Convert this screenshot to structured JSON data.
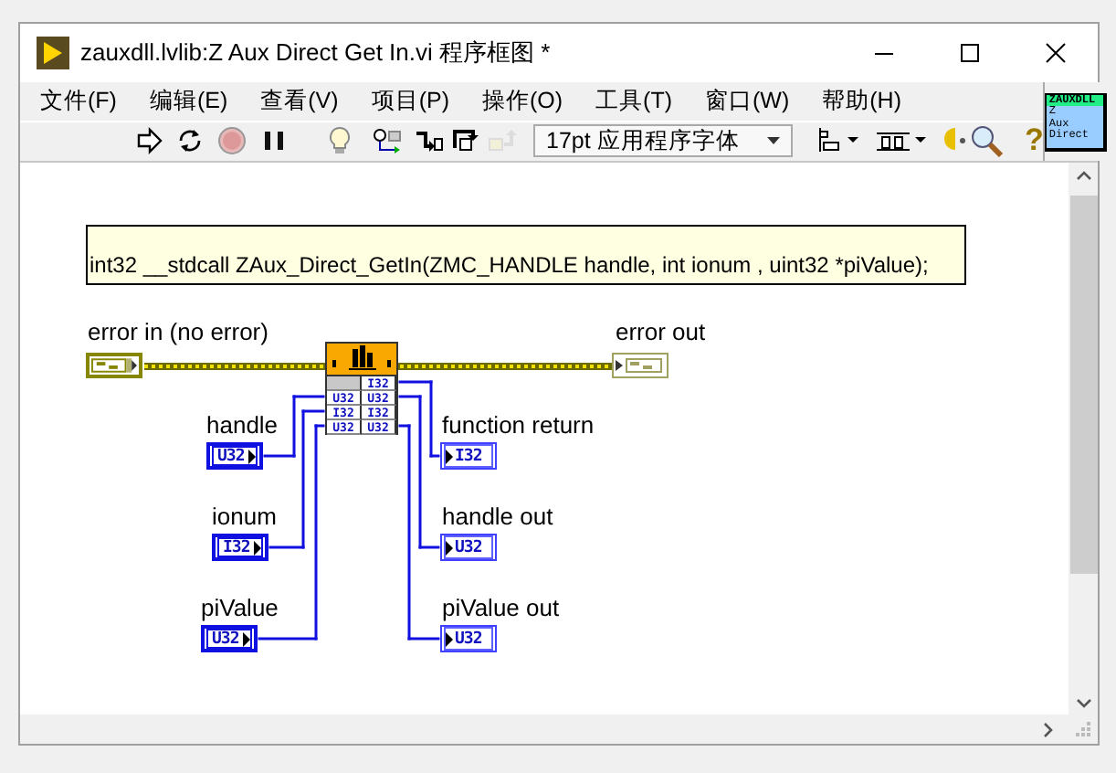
{
  "window": {
    "title": "zauxdll.lvlib:Z Aux Direct Get In.vi 程序框图 *"
  },
  "menu": [
    "文件(F)",
    "编辑(E)",
    "查看(V)",
    "项目(P)",
    "操作(O)",
    "工具(T)",
    "窗口(W)",
    "帮助(H)"
  ],
  "toolbar": {
    "buttons": [
      {
        "kind": "run",
        "disabled": false
      },
      {
        "kind": "run-continuous",
        "disabled": false
      },
      {
        "kind": "abort",
        "disabled": false
      },
      {
        "kind": "pause",
        "disabled": false
      },
      {
        "kind": "highlight",
        "disabled": false
      },
      {
        "kind": "retain",
        "disabled": false
      },
      {
        "kind": "step-into",
        "disabled": false
      },
      {
        "kind": "step-over",
        "disabled": false
      },
      {
        "kind": "step-out",
        "disabled": true
      }
    ],
    "font": "17pt 应用程序字体",
    "tools": [
      {
        "kind": "align"
      },
      {
        "kind": "distribute"
      },
      {
        "kind": "cleanup"
      },
      {
        "kind": "search"
      },
      {
        "kind": "help",
        "glyph": "?"
      }
    ]
  },
  "vi_icon": {
    "lines": [
      "ZAUXDLL",
      "Z",
      "Aux",
      "Direct"
    ]
  },
  "diagram": {
    "comment": "int32 __stdcall ZAux_Direct_GetIn(ZMC_HANDLE handle, int ionum , uint32 *piValue);",
    "error_in": {
      "label": "error in (no error)"
    },
    "error_out": {
      "label": "error out"
    },
    "node": {
      "input_types": [
        "U32",
        "I32",
        "U32"
      ],
      "output_types": [
        "I32",
        "U32",
        "I32",
        "U32"
      ]
    },
    "controls": [
      {
        "label": "handle",
        "type": "U32"
      },
      {
        "label": "ionum",
        "type": "I32"
      },
      {
        "label": "piValue",
        "type": "U32"
      }
    ],
    "indicators": [
      {
        "label": "function return",
        "type": "I32"
      },
      {
        "label": "handle out",
        "type": "U32"
      },
      {
        "label": "piValue out",
        "type": "U32"
      }
    ]
  }
}
